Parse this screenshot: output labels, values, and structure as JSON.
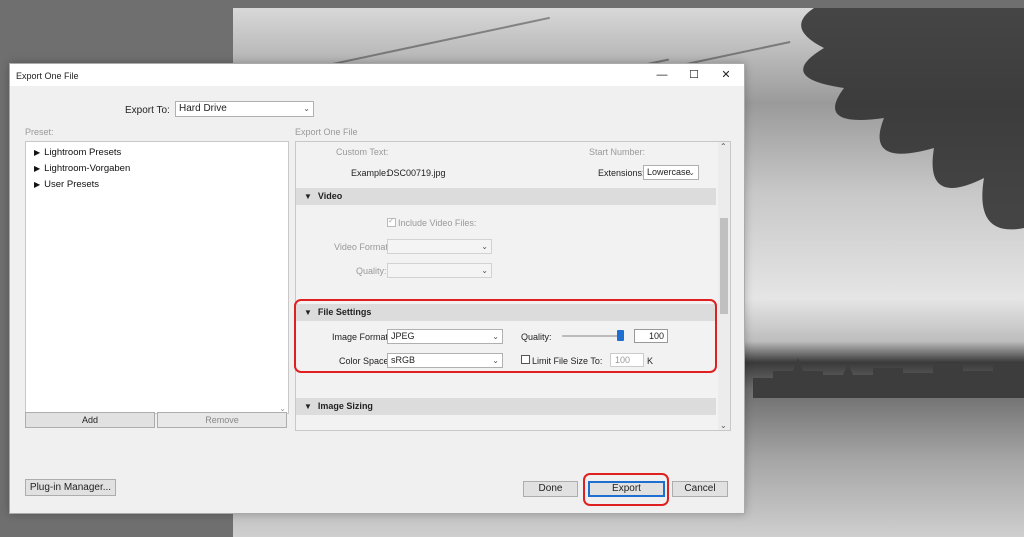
{
  "dialog": {
    "title": "Export One File",
    "export_to_label": "Export To:",
    "export_to_value": "Hard Drive",
    "minimize": "—",
    "maximize": "☐",
    "close": "✕"
  },
  "preset": {
    "label": "Preset:",
    "items": [
      "Lightroom Presets",
      "Lightroom-Vorgaben",
      "User Presets"
    ],
    "add": "Add",
    "remove": "Remove"
  },
  "panel": {
    "label": "Export One File",
    "custom_text": "Custom Text:",
    "start_number": "Start Number:",
    "example_label": "Example:",
    "example_value": "DSC00719.jpg",
    "extensions_label": "Extensions:",
    "extensions_value": "Lowercase",
    "video": {
      "title": "Video",
      "include": "Include Video Files:",
      "format_label": "Video Format:",
      "quality_label": "Quality:"
    },
    "file_settings": {
      "title": "File Settings",
      "image_format_label": "Image Format:",
      "image_format_value": "JPEG",
      "quality_label": "Quality:",
      "quality_value": "100",
      "quality_level": 1.0,
      "color_space_label": "Color Space:",
      "color_space_value": "sRGB",
      "limit_label": "Limit File Size To:",
      "limit_value": "100",
      "limit_unit": "K"
    },
    "image_sizing": {
      "title": "Image Sizing"
    }
  },
  "footer": {
    "plugin_manager": "Plug-in Manager...",
    "done": "Done",
    "export": "Export",
    "cancel": "Cancel"
  },
  "colors": {
    "highlight": "#e02020",
    "slider": "#1e6fd0"
  }
}
